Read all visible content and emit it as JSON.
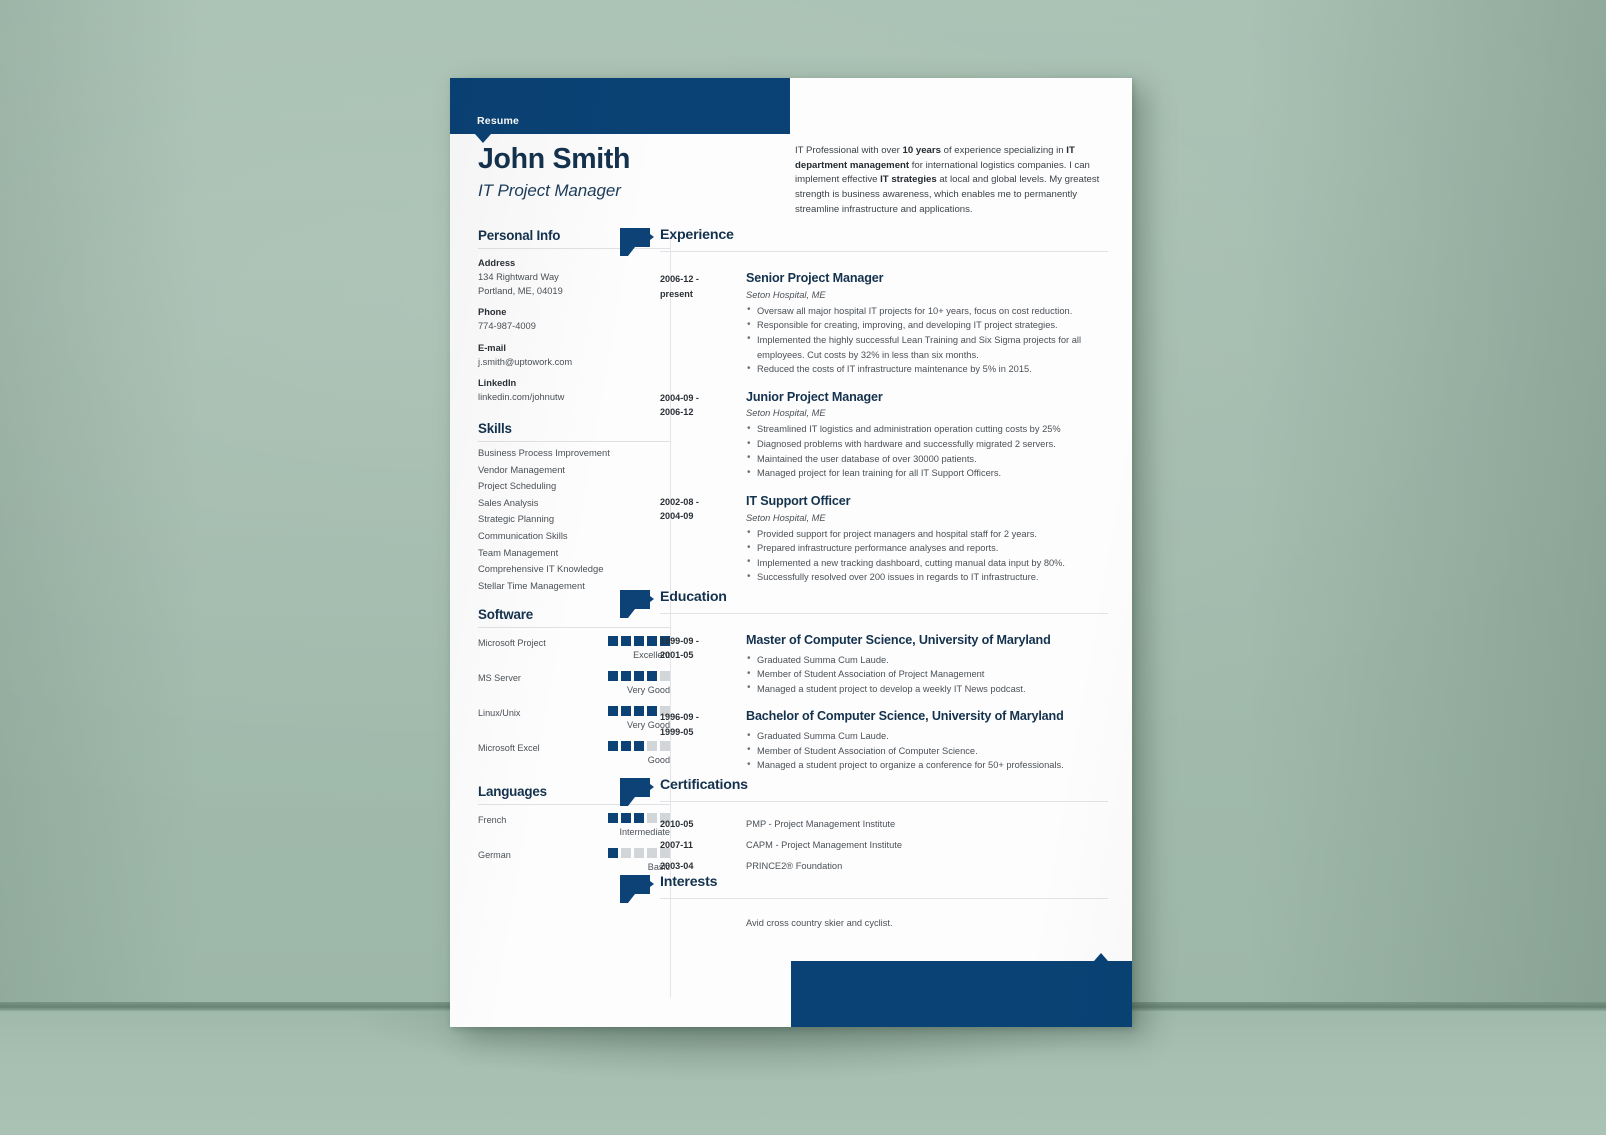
{
  "scene": {
    "background_color": "#a3bcae",
    "accent_blue": "#0a4275",
    "paper_color": "#fdfdfd"
  },
  "banner": {
    "label": "Resume"
  },
  "header": {
    "name": "John Smith",
    "job_title": "IT Project Manager"
  },
  "summary": {
    "part1": "IT Professional with over ",
    "bold1": "10 years",
    "part2": " of experience specializing in ",
    "bold2": "IT department management",
    "part3": " for international logistics companies. I can implement effective ",
    "bold3": "IT strategies",
    "part4": " at local and global levels. My greatest strength is business awareness, which enables me to permanently streamline infrastructure and applications."
  },
  "personal_info": {
    "title": "Personal Info",
    "entries": [
      {
        "label": "Address",
        "value": "134 Rightward Way\nPortland, ME, 04019"
      },
      {
        "label": "Phone",
        "value": "774-987-4009"
      },
      {
        "label": "E-mail",
        "value": "j.smith@uptowork.com"
      },
      {
        "label": "LinkedIn",
        "value": "linkedin.com/johnutw"
      }
    ]
  },
  "skills": {
    "title": "Skills",
    "items": [
      "Business Process Improvement",
      "Vendor Management",
      "Project Scheduling",
      "Sales Analysis",
      "Strategic Planning",
      "Communication Skills",
      "Team Management",
      "Comprehensive IT Knowledge",
      "Stellar Time Management"
    ]
  },
  "software": {
    "title": "Software",
    "max_rating": 5,
    "items": [
      {
        "name": "Microsoft Project",
        "rating": 5,
        "word": "Excellent"
      },
      {
        "name": "MS Server",
        "rating": 4,
        "word": "Very Good"
      },
      {
        "name": "Linux/Unix",
        "rating": 4,
        "word": "Very Good"
      },
      {
        "name": "Microsoft Excel",
        "rating": 3,
        "word": "Good"
      }
    ]
  },
  "languages": {
    "title": "Languages",
    "max_rating": 5,
    "items": [
      {
        "name": "French",
        "rating": 3,
        "word": "Intermediate"
      },
      {
        "name": "German",
        "rating": 1,
        "word": "Basic"
      }
    ]
  },
  "experience": {
    "title": "Experience",
    "entries": [
      {
        "date": "2006-12 -\npresent",
        "role": "Senior Project Manager",
        "org": "Seton Hospital, ME",
        "bullets": [
          "Oversaw all major hospital IT projects for 10+ years, focus on cost reduction.",
          "Responsible for creating, improving, and developing IT project strategies.",
          "Implemented the highly successful Lean Training and Six Sigma projects for all employees. Cut costs by 32% in less than six months.",
          "Reduced the costs of IT infrastructure maintenance by 5% in 2015."
        ]
      },
      {
        "date": "2004-09 -\n2006-12",
        "role": "Junior Project Manager",
        "org": "Seton Hospital, ME",
        "bullets": [
          "Streamlined IT logistics and administration operation cutting costs by 25%",
          "Diagnosed problems with hardware and successfully migrated 2 servers.",
          "Maintained the user database of over 30000 patients.",
          "Managed project for lean training for all IT Support Officers."
        ]
      },
      {
        "date": "2002-08 -\n2004-09",
        "role": "IT Support Officer",
        "org": "Seton Hospital, ME",
        "bullets": [
          "Provided support for project managers and hospital staff for 2 years.",
          "Prepared infrastructure performance analyses and reports.",
          "Implemented a new tracking dashboard, cutting manual data input by 80%.",
          "Successfully resolved over 200 issues in regards to IT infrastructure."
        ]
      }
    ]
  },
  "education": {
    "title": "Education",
    "entries": [
      {
        "date": "1999-09 -\n2001-05",
        "role": "Master of Computer Science, University of Maryland",
        "org": "",
        "bullets": [
          "Graduated Summa Cum Laude.",
          "Member of Student Association of Project Management",
          "Managed a student project to develop a weekly IT News podcast."
        ]
      },
      {
        "date": "1996-09 -\n1999-05",
        "role": "Bachelor of Computer Science, University of Maryland",
        "org": "",
        "bullets": [
          "Graduated Summa Cum Laude.",
          "Member of Student Association of Computer Science.",
          "Managed a student project to organize a conference for 50+ professionals."
        ]
      }
    ]
  },
  "certifications": {
    "title": "Certifications",
    "entries": [
      {
        "date": "2010-05",
        "text": "PMP - Project Management Institute"
      },
      {
        "date": "2007-11",
        "text": "CAPM - Project Management Institute"
      },
      {
        "date": "2003-04",
        "text": "PRINCE2® Foundation"
      }
    ]
  },
  "interests": {
    "title": "Interests",
    "text": "Avid cross country skier and cyclist."
  }
}
